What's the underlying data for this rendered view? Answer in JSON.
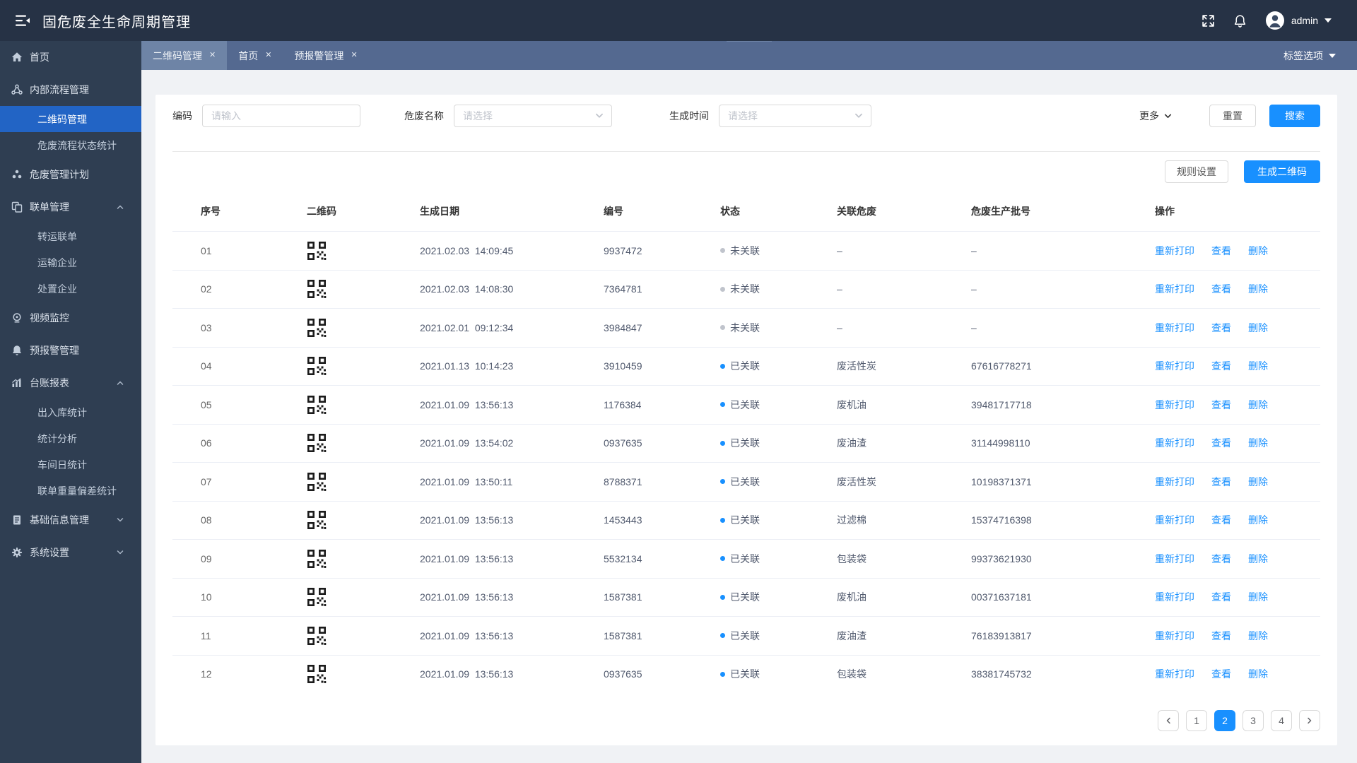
{
  "app": {
    "title": "固危废全生命周期管理"
  },
  "header": {
    "user_name": "admin"
  },
  "tabbar": {
    "tabs": [
      {
        "label": "二维码管理"
      },
      {
        "label": "首页"
      },
      {
        "label": "预报警管理"
      }
    ],
    "active_tab": "二维码管理",
    "options_label": "标签选项"
  },
  "sidebar": {
    "active_item": "二维码管理",
    "items": [
      {
        "label": "首页"
      },
      {
        "label": "内部流程管理",
        "children": [
          {
            "label": "二维码管理"
          },
          {
            "label": "危废流程状态统计"
          }
        ]
      },
      {
        "label": "危废管理计划"
      },
      {
        "label": "联单管理",
        "children": [
          {
            "label": "转运联单"
          },
          {
            "label": "运输企业"
          },
          {
            "label": "处置企业"
          }
        ]
      },
      {
        "label": "视频监控"
      },
      {
        "label": "预报警管理"
      },
      {
        "label": "台账报表",
        "children": [
          {
            "label": "出入库统计"
          },
          {
            "label": "统计分析"
          },
          {
            "label": "车间日统计"
          },
          {
            "label": "联单重量偏差统计"
          }
        ]
      },
      {
        "label": "基础信息管理"
      },
      {
        "label": "系统设置"
      }
    ]
  },
  "filters": {
    "code_label": "编码",
    "code_placeholder": "请输入",
    "waste_label": "危废名称",
    "waste_placeholder": "请选择",
    "time_label": "生成时间",
    "time_placeholder": "请选择",
    "more_label": "更多",
    "reset_label": "重置",
    "search_label": "搜索"
  },
  "toolbar": {
    "rule_settings_label": "规则设置",
    "generate_label": "生成二维码"
  },
  "table": {
    "columns": [
      "序号",
      "二维码",
      "生成日期",
      "编号",
      "状态",
      "关联危废",
      "危废生产批号",
      "操作"
    ],
    "actions": [
      "重新打印",
      "查看",
      "删除"
    ],
    "rows": [
      {
        "seq": "01",
        "date": "2021.02.03  14:09:45",
        "code": "9937472",
        "status": "未关联",
        "linked": false,
        "waste": "–",
        "batch": "–"
      },
      {
        "seq": "02",
        "date": "2021.02.03  14:08:30",
        "code": "7364781",
        "status": "未关联",
        "linked": false,
        "waste": "–",
        "batch": "–"
      },
      {
        "seq": "03",
        "date": "2021.02.01  09:12:34",
        "code": "3984847",
        "status": "未关联",
        "linked": false,
        "waste": "–",
        "batch": "–"
      },
      {
        "seq": "04",
        "date": "2021.01.13  10:14:23",
        "code": "3910459",
        "status": "已关联",
        "linked": true,
        "waste": "废活性炭",
        "batch": "67616778271"
      },
      {
        "seq": "05",
        "date": "2021.01.09  13:56:13",
        "code": "1176384",
        "status": "已关联",
        "linked": true,
        "waste": "废机油",
        "batch": "39481717718"
      },
      {
        "seq": "06",
        "date": "2021.01.09  13:54:02",
        "code": "0937635",
        "status": "已关联",
        "linked": true,
        "waste": "废油渣",
        "batch": "31144998110"
      },
      {
        "seq": "07",
        "date": "2021.01.09  13:50:11",
        "code": "8788371",
        "status": "已关联",
        "linked": true,
        "waste": "废活性炭",
        "batch": "10198371371"
      },
      {
        "seq": "08",
        "date": "2021.01.09  13:56:13",
        "code": "1453443",
        "status": "已关联",
        "linked": true,
        "waste": "过滤棉",
        "batch": "15374716398"
      },
      {
        "seq": "09",
        "date": "2021.01.09  13:56:13",
        "code": "5532134",
        "status": "已关联",
        "linked": true,
        "waste": "包装袋",
        "batch": "99373621930"
      },
      {
        "seq": "10",
        "date": "2021.01.09  13:56:13",
        "code": "1587381",
        "status": "已关联",
        "linked": true,
        "waste": "废机油",
        "batch": "00371637181"
      },
      {
        "seq": "11",
        "date": "2021.01.09  13:56:13",
        "code": "1587381",
        "status": "已关联",
        "linked": true,
        "waste": "废油渣",
        "batch": "76183913817"
      },
      {
        "seq": "12",
        "date": "2021.01.09  13:56:13",
        "code": "0937635",
        "status": "已关联",
        "linked": true,
        "waste": "包装袋",
        "batch": "38381745732"
      }
    ]
  },
  "pagination": {
    "pages": [
      "1",
      "2",
      "3",
      "4"
    ],
    "active_page": "2"
  },
  "icons": {
    "close": "✕"
  },
  "colors": {
    "accent": "#1890ff",
    "sidebar_active": "#2264c5",
    "tabbar": "#546990",
    "header": "#263245",
    "sidebar": "#2f3e52",
    "status_linked_dot": "#1890ff",
    "status_unlinked_dot": "#c0c4cc"
  }
}
